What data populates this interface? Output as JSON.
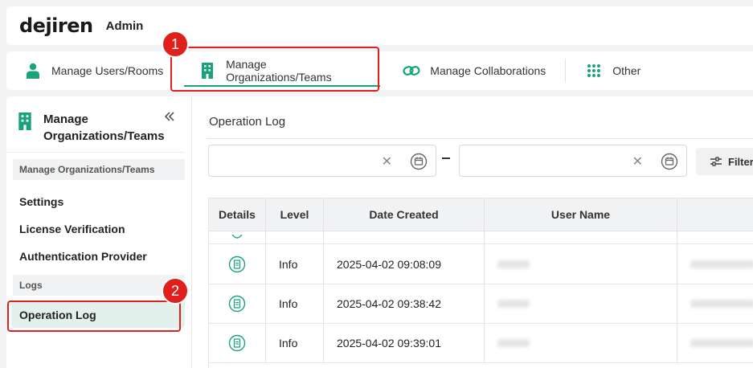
{
  "header": {
    "logo": "dejiren",
    "title": "Admin"
  },
  "nav": {
    "tabs": [
      {
        "label": "Manage Users/Rooms",
        "icon": "user-icon"
      },
      {
        "label": "Manage Organizations/Teams",
        "icon": "building-icon",
        "active": true
      },
      {
        "label": "Manage Collaborations",
        "icon": "link-icon"
      },
      {
        "label": "Other",
        "icon": "grid-dots-icon"
      }
    ]
  },
  "sidebar": {
    "title": "Manage Organizations/Teams",
    "groups": [
      {
        "label": "Manage Organizations/Teams",
        "items": [
          "Settings",
          "License Verification",
          "Authentication Provider"
        ]
      },
      {
        "label": "Logs",
        "items": [
          "Operation Log"
        ]
      }
    ],
    "active_item": "Operation Log"
  },
  "main": {
    "title": "Operation Log",
    "date_separator": "–",
    "filter_label": "Filter",
    "table": {
      "columns": [
        "Details",
        "Level",
        "Date Created",
        "User Name"
      ],
      "rows": [
        {
          "level": "Info",
          "date": "2025-04-02 09:08:09"
        },
        {
          "level": "Info",
          "date": "2025-04-02 09:38:42"
        },
        {
          "level": "Info",
          "date": "2025-04-02 09:39:01"
        }
      ]
    }
  },
  "callouts": [
    "1",
    "2"
  ],
  "colors": {
    "accent": "#1aa37a",
    "callout": "#e0201c",
    "active_bg": "#e3f1ec"
  }
}
